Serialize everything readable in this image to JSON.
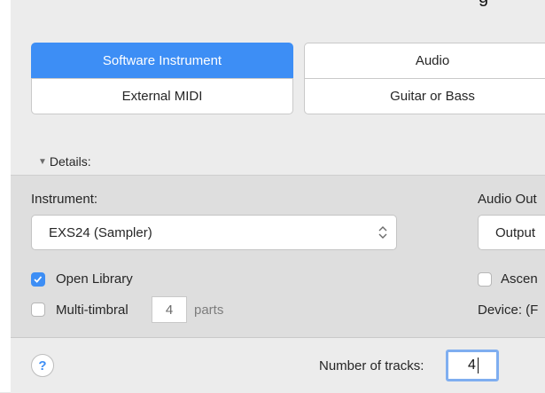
{
  "window": {
    "title_fragment": "g"
  },
  "track_types": [
    {
      "label": "Software Instrument",
      "selected": true
    },
    {
      "label": "Audio",
      "selected": false
    },
    {
      "label": "External MIDI",
      "selected": false
    },
    {
      "label": "Guitar or Bass",
      "selected": false
    }
  ],
  "details": {
    "disclosure_icon": "triangle-down-icon",
    "label": "Details:"
  },
  "instrument": {
    "label": "Instrument:",
    "value": "EXS24  (Sampler)",
    "select_icon": "up-down-chevron-icon"
  },
  "audio_output": {
    "label": "Audio Out",
    "value": "Output"
  },
  "options": {
    "open_library": {
      "label": "Open Library",
      "checked": true
    },
    "multi_timbral": {
      "label": "Multi-timbral",
      "checked": false,
      "parts_value": "4",
      "parts_label": "parts"
    },
    "ascending": {
      "label": "Ascen",
      "checked": false
    },
    "device": {
      "label": "Device: (F"
    }
  },
  "footer": {
    "help_label": "?",
    "num_tracks_label": "Number of tracks:",
    "num_tracks_value": "4"
  },
  "colors": {
    "accent": "#3d8ef5",
    "panel": "#ececec",
    "panel_details": "#dedede"
  }
}
